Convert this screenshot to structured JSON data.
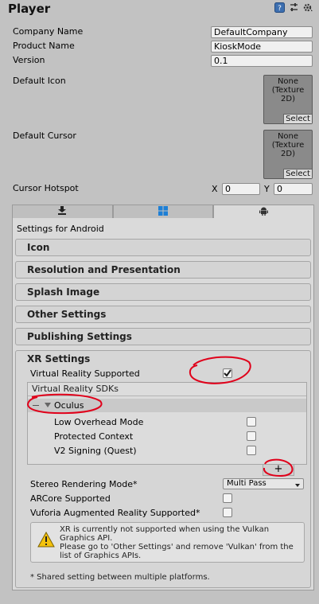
{
  "header": {
    "title": "Player",
    "icons": [
      "help-book-icon",
      "preset-sliders-icon",
      "gear-icon"
    ]
  },
  "player": {
    "company_label": "Company Name",
    "company_value": "DefaultCompany",
    "product_label": "Product Name",
    "product_value": "KioskMode",
    "version_label": "Version",
    "version_value": "0.1",
    "default_icon_label": "Default Icon",
    "default_icon_value_1": "None",
    "default_icon_value_2": "(Texture",
    "default_icon_value_3": "2D)",
    "default_icon_select": "Select",
    "default_cursor_label": "Default Cursor",
    "default_cursor_value_1": "None",
    "default_cursor_value_2": "(Texture",
    "default_cursor_value_3": "2D)",
    "default_cursor_select": "Select",
    "cursor_hotspot_label": "Cursor Hotspot",
    "hotspot_x_label": "X",
    "hotspot_x_value": "0",
    "hotspot_y_label": "Y",
    "hotspot_y_value": "0"
  },
  "tabs": [
    {
      "icon": "download-icon",
      "active": false
    },
    {
      "icon": "windows-icon",
      "active": false
    },
    {
      "icon": "android-icon",
      "active": true
    }
  ],
  "settings_for": "Settings for Android",
  "sections": {
    "icon": "Icon",
    "resolution": "Resolution and Presentation",
    "splash": "Splash Image",
    "other": "Other Settings",
    "publishing": "Publishing Settings",
    "xr": "XR Settings"
  },
  "xr": {
    "vr_supported_label": "Virtual Reality Supported",
    "vr_supported_checked": true,
    "sdks_label": "Virtual Reality SDKs",
    "sdk_name": "Oculus",
    "low_overhead_label": "Low Overhead Mode",
    "protected_context_label": "Protected Context",
    "v2_signing_label": "V2 Signing (Quest)",
    "add_button": "+",
    "stereo_label": "Stereo Rendering Mode*",
    "stereo_value": "Multi Pass",
    "arcore_label": "ARCore Supported",
    "vuforia_label": "Vuforia Augmented Reality Supported*",
    "warning_line1": "XR is currently not supported when using the Vulkan",
    "warning_line2": "Graphics API.",
    "warning_line3": "Please go to 'Other Settings' and remove 'Vulkan' from the",
    "warning_line4": "list of Graphics APIs.",
    "shared_note": "* Shared setting between multiple platforms."
  },
  "colors": {
    "annotation": "#e0001a",
    "background": "#c2c2c2",
    "panel": "#dadada",
    "warning": "#f4c20d"
  }
}
